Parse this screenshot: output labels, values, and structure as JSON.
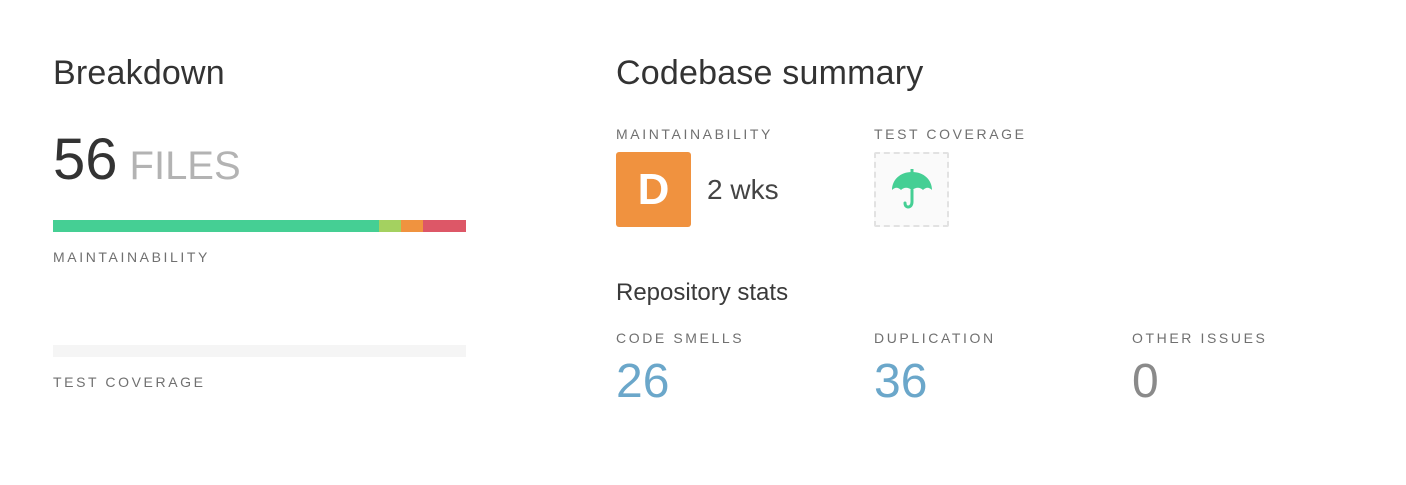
{
  "breakdown": {
    "title": "Breakdown",
    "file_count": "56",
    "files_label": "FILES",
    "maintainability_label": "MAINTAINABILITY",
    "maintainability_distribution": [
      {
        "rating": "A",
        "fraction": 0.79,
        "color": "#45cf94"
      },
      {
        "rating": "B",
        "fraction": 0.053,
        "color": "#a4d160"
      },
      {
        "rating": "C",
        "fraction": 0.052,
        "color": "#f0933f"
      },
      {
        "rating": "D",
        "fraction": 0.105,
        "color": "#dd5767"
      }
    ],
    "test_coverage_label": "TEST COVERAGE"
  },
  "summary": {
    "title": "Codebase summary",
    "maintainability": {
      "label": "MAINTAINABILITY",
      "grade": "D",
      "grade_color": "#f0923f",
      "time": "2 wks"
    },
    "test_coverage": {
      "label": "TEST COVERAGE",
      "icon": "umbrella-icon",
      "icon_color": "#45cf94"
    },
    "repository_stats": {
      "title": "Repository stats",
      "items": [
        {
          "label": "CODE SMELLS",
          "value": "26",
          "color": "#6ba7ca"
        },
        {
          "label": "DUPLICATION",
          "value": "36",
          "color": "#6ba7ca"
        },
        {
          "label": "OTHER ISSUES",
          "value": "0",
          "color": "#8a8a8a"
        }
      ]
    }
  }
}
